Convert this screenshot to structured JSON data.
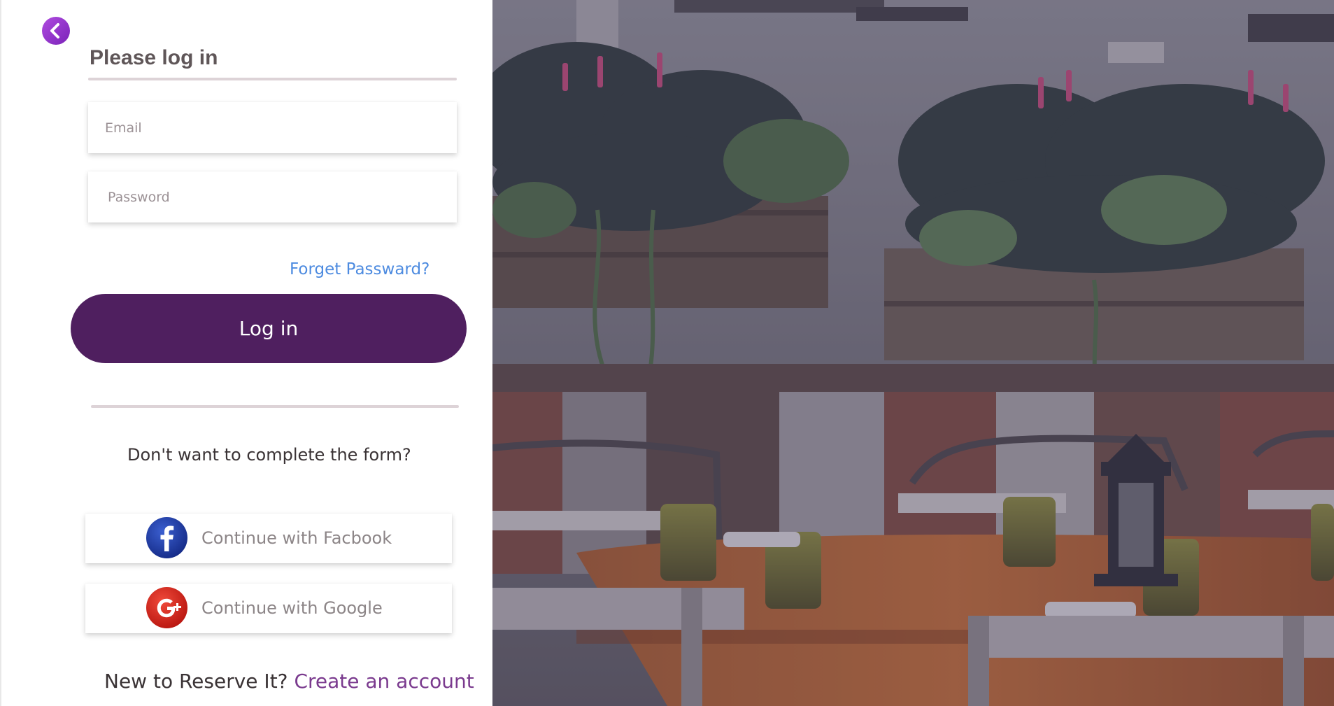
{
  "login": {
    "title": "Please log in",
    "email_placeholder": "Email",
    "password_placeholder": "Password",
    "forgot_password": "Forget Passward?",
    "login_button": "Log in",
    "alt_prompt": "Don't want to complete the form?",
    "facebook_label": "Continue with Facbook",
    "google_label": "Continue with Google",
    "signup_prompt": "New to Reserve It?",
    "signup_link": "Create an account"
  },
  "icons": {
    "back": "chevron-left-icon",
    "facebook": "facebook-icon",
    "google": "google-plus-icon"
  },
  "colors": {
    "primary": "#4f1f5f",
    "back_button": "#9b36d0",
    "link_blue": "#4d8be0",
    "link_purple": "#7a3a8e",
    "facebook_blue": "#1d3a9e",
    "google_red": "#d8231f"
  }
}
